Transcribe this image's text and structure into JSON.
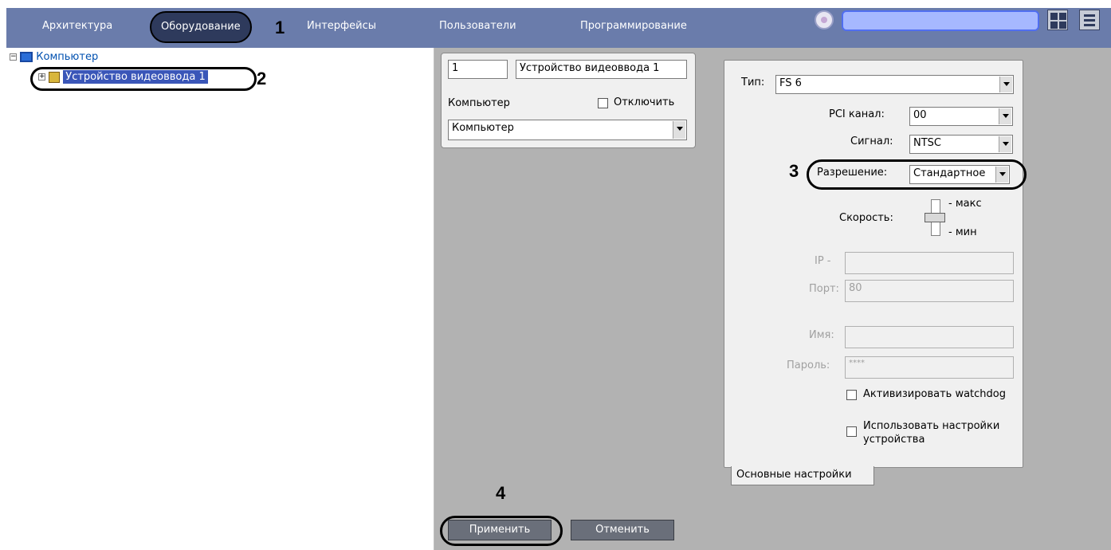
{
  "tabs": [
    {
      "label": "Архитектура"
    },
    {
      "label": "Оборудование"
    },
    {
      "label": "Интерфейсы"
    },
    {
      "label": "Пользователи"
    },
    {
      "label": "Программирование"
    }
  ],
  "markers": {
    "m1": "1",
    "m2": "2",
    "m3": "3",
    "m4": "4"
  },
  "tree": {
    "root_label": "Компьютер",
    "child_label": "Устройство видеоввода 1"
  },
  "device": {
    "id_value": "1",
    "name_value": "Устройство видеоввода 1",
    "computer_label": "Компьютер",
    "disable_label": "Отключить",
    "computer_value": "Компьютер"
  },
  "settings": {
    "type_label": "Тип:",
    "type_value": "FS 6",
    "pci_label": "PCI канал:",
    "pci_value": "00",
    "signal_label": "Сигнал:",
    "signal_value": "NTSC",
    "resolution_label": "Разрешение:",
    "resolution_value": "Стандартное",
    "speed_label": "Скорость:",
    "speed_max": "макс",
    "speed_min": "мин",
    "ip_label": "IP -",
    "port_label": "Порт:",
    "port_value": "80",
    "name_label": "Имя:",
    "password_label": "Пароль:",
    "password_value": "****",
    "watchdog_label": "Активизировать  watchdog",
    "use_device_settings_line1": "Использовать настройки",
    "use_device_settings_line2": "устройства",
    "tab_main": "Основные настройки"
  },
  "buttons": {
    "apply": "Применить",
    "cancel": "Отменить"
  }
}
